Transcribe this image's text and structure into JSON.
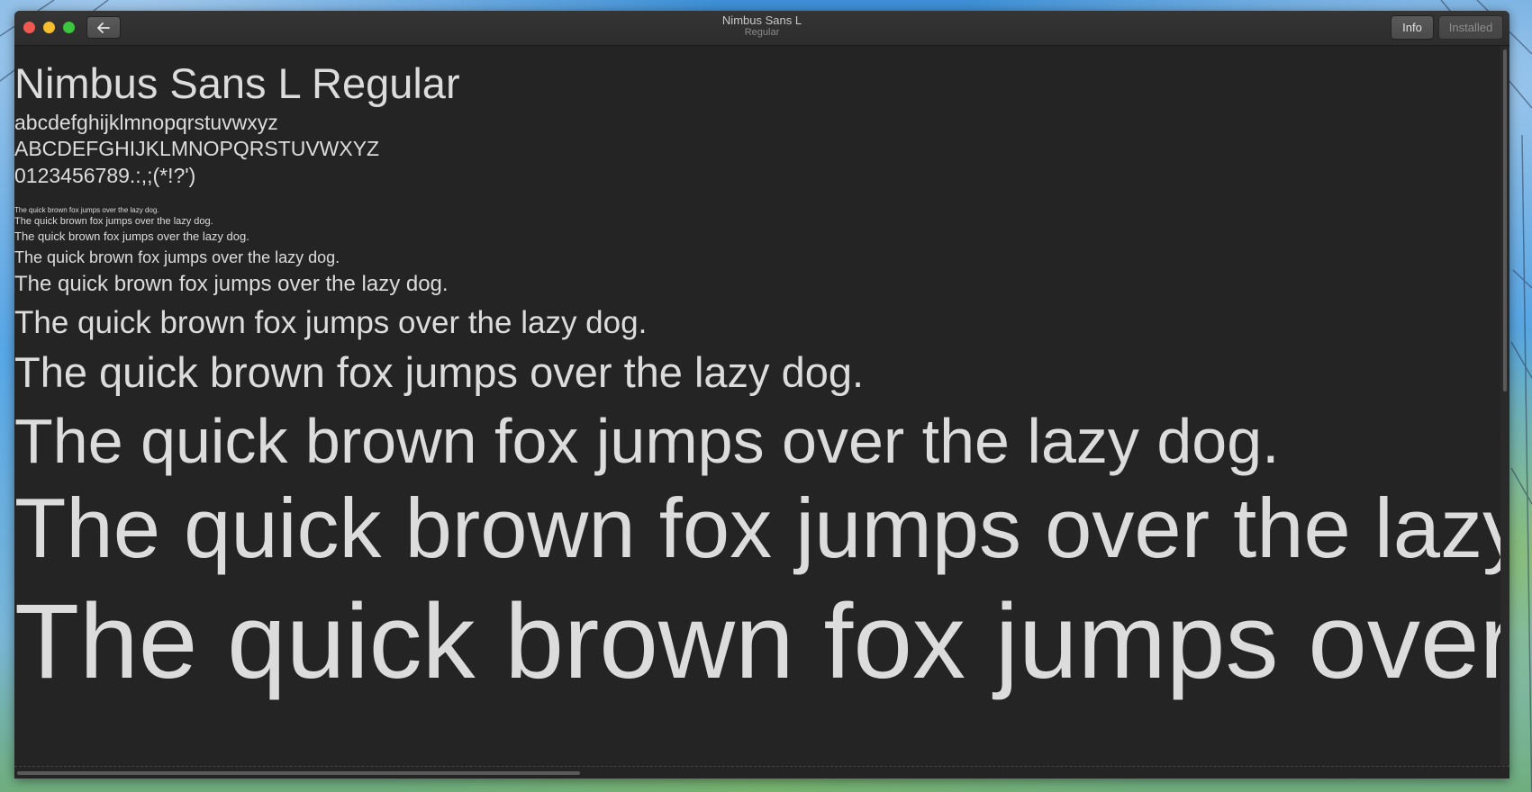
{
  "window": {
    "title": "Nimbus Sans L",
    "subtitle": "Regular",
    "buttons": {
      "info": "Info",
      "installed": "Installed"
    },
    "icons": {
      "back": "arrow-left-icon",
      "close": "close-dot",
      "minimize": "minimize-dot",
      "maximize": "maximize-dot"
    },
    "colors": {
      "close": "#ee5a52",
      "minimize": "#f5be2f",
      "maximize": "#3dc53f",
      "background": "#242424",
      "text": "#dcdcdc"
    }
  },
  "preview": {
    "heading": "Nimbus Sans L Regular",
    "lowercase": "abcdefghijklmnopqrstuvwxyz",
    "uppercase": "ABCDEFGHIJKLMNOPQRSTUVWXYZ",
    "digits": "0123456789.:,;(*!?')",
    "sample_text": "The quick brown fox jumps over the lazy dog.",
    "samples": [
      "The quick brown fox jumps over the lazy dog.",
      "The quick brown fox jumps over the lazy dog.",
      "The quick brown fox jumps over the lazy dog.",
      "The quick brown fox jumps over the lazy dog.",
      "The quick brown fox jumps over the lazy dog.",
      "The quick brown fox jumps over the lazy dog.",
      "The quick brown fox jumps over the lazy dog.",
      "The quick brown fox jumps over the lazy dog.",
      "The quick brown fox jumps over the lazy dog.",
      "The quick brown fox jumps over the lazy dog."
    ]
  }
}
